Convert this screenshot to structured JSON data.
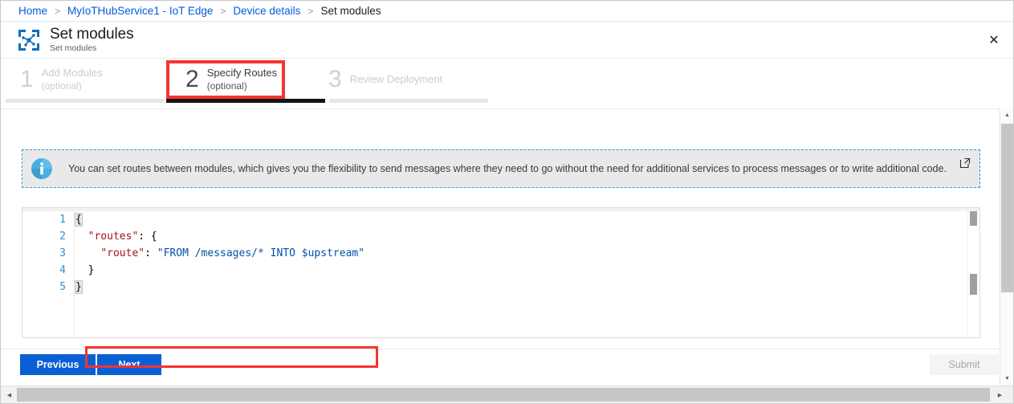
{
  "breadcrumb": {
    "items": [
      {
        "label": "Home",
        "current": false
      },
      {
        "label": "MyIoTHubService1 - IoT Edge",
        "current": false
      },
      {
        "label": "Device details",
        "current": false
      },
      {
        "label": "Set modules",
        "current": true
      }
    ],
    "separator": ">"
  },
  "header": {
    "title": "Set modules",
    "subtitle": "Set modules",
    "icon": "iot-edge-modules-icon",
    "close_label": "✕"
  },
  "stepper": {
    "steps": [
      {
        "number": "1",
        "label": "Add Modules",
        "optional": "(optional)",
        "active": false
      },
      {
        "number": "2",
        "label": "Specify Routes",
        "optional": "(optional)",
        "active": true
      },
      {
        "number": "3",
        "label": "Review Deployment",
        "optional": "",
        "active": false
      }
    ]
  },
  "notice": {
    "icon": "info-icon",
    "text": "You can set routes between modules, which gives you the flexibility to send messages where they need to go without the need for additional services to process messages or to write additional code.",
    "external_link_icon": "external-link-icon"
  },
  "editor": {
    "line_numbers": [
      "1",
      "2",
      "3",
      "4",
      "5"
    ],
    "lines": [
      {
        "indent": "",
        "tokens": [
          {
            "t": "{",
            "c": "punc"
          }
        ]
      },
      {
        "indent": "  ",
        "tokens": [
          {
            "t": "\"routes\"",
            "c": "key"
          },
          {
            "t": ": {",
            "c": "punc"
          }
        ]
      },
      {
        "indent": "    ",
        "tokens": [
          {
            "t": "\"route\"",
            "c": "key"
          },
          {
            "t": ": ",
            "c": "punc"
          },
          {
            "t": "\"FROM /messages/* INTO $upstream\"",
            "c": "str"
          }
        ]
      },
      {
        "indent": "  ",
        "tokens": [
          {
            "t": "}",
            "c": "punc"
          }
        ]
      },
      {
        "indent": "",
        "tokens": [
          {
            "t": "}",
            "c": "punc"
          }
        ]
      }
    ]
  },
  "footer": {
    "previous_label": "Previous",
    "next_label": "Next",
    "submit_label": "Submit"
  },
  "colors": {
    "accent_blue": "#0a5fd4",
    "link_blue": "#015cda",
    "highlight_red": "#f6342f",
    "json_key": "#a31515",
    "json_string": "#0451a5",
    "line_number": "#2b91d6"
  }
}
